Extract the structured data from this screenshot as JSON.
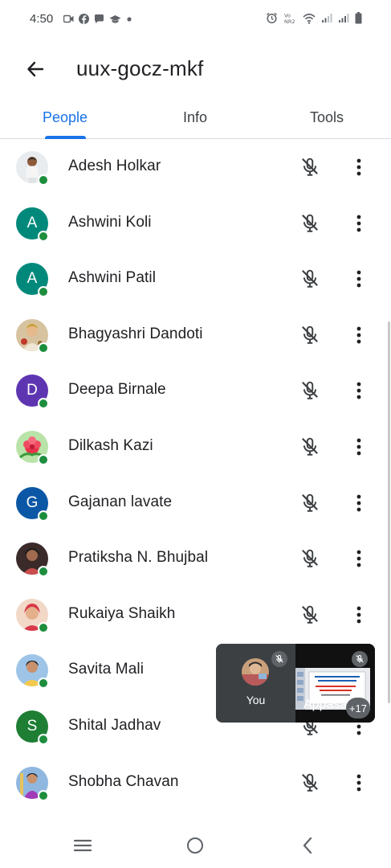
{
  "status_bar": {
    "time": "4:50"
  },
  "header": {
    "title": "uux-gocz-mkf"
  },
  "tabs": [
    {
      "label": "People",
      "active": true
    },
    {
      "label": "Info",
      "active": false
    },
    {
      "label": "Tools",
      "active": false
    }
  ],
  "participants": [
    {
      "name": "Adesh Holkar",
      "avatar": "photo",
      "muted": true
    },
    {
      "name": "Ashwini Koli",
      "avatar": "initial",
      "initial": "A",
      "color": "#00897b",
      "muted": true
    },
    {
      "name": "Ashwini Patil",
      "avatar": "initial",
      "initial": "A",
      "color": "#00897b",
      "muted": true
    },
    {
      "name": "Bhagyashri Dandoti",
      "avatar": "photo",
      "muted": true
    },
    {
      "name": "Deepa Birnale",
      "avatar": "initial",
      "initial": "D",
      "color": "#5e35b1",
      "muted": true
    },
    {
      "name": "Dilkash Kazi",
      "avatar": "photo",
      "muted": true
    },
    {
      "name": "Gajanan lavate",
      "avatar": "initial",
      "initial": "G",
      "color": "#0b57a6",
      "muted": true
    },
    {
      "name": "Pratiksha N. Bhujbal",
      "avatar": "photo",
      "muted": true
    },
    {
      "name": "Rukaiya Shaikh",
      "avatar": "photo",
      "muted": true
    },
    {
      "name": "Savita Mali",
      "avatar": "photo",
      "muted": true
    },
    {
      "name": "Shital Jadhav",
      "avatar": "initial",
      "initial": "S",
      "color": "#1e7e34",
      "muted": true
    },
    {
      "name": "Shobha Chavan",
      "avatar": "photo",
      "muted": true
    }
  ],
  "pip": {
    "self_label": "You",
    "other_label": "Appasa",
    "more_count": "+17"
  },
  "colors": {
    "accent": "#1a73e8",
    "online": "#1e8e3e",
    "icon": "#3c4043"
  }
}
